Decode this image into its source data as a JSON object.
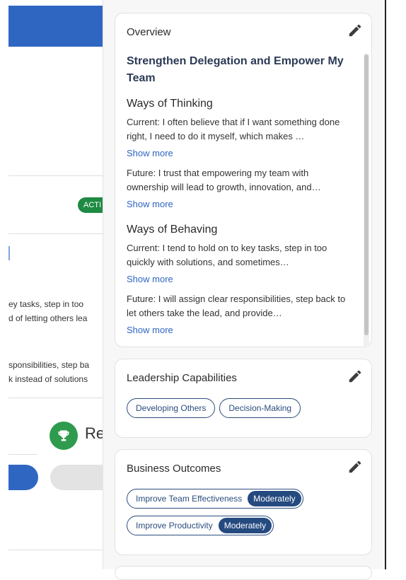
{
  "background": {
    "badge": "ACTI",
    "current_snippet_1": "ey tasks, step in too",
    "current_snippet_2": "d of letting others lea",
    "future_snippet_1": "sponsibilities, step ba",
    "future_snippet_2": "k instead of solutions",
    "section_heading": "Re"
  },
  "overview": {
    "title": "Overview",
    "goal_title": "Strengthen Delegation and Empower My Team",
    "thinking": {
      "title": "Ways of Thinking",
      "current": "Current: I often believe that if I want something done right, I need to do it myself, which makes …",
      "future": "Future: I trust that empowering my team with ownership will lead to growth, innovation, and…"
    },
    "behaving": {
      "title": "Ways of Behaving",
      "current": "Current: I tend to hold on to key tasks, step in too quickly with solutions, and sometimes…",
      "future": "Future: I will assign clear responsibilities, step back to let others take the lead, and provide…"
    },
    "show_more": "Show more"
  },
  "leadership": {
    "title": "Leadership Capabilities",
    "chips": [
      "Developing Others",
      "Decision-Making"
    ]
  },
  "outcomes": {
    "title": "Business Outcomes",
    "items": [
      {
        "label": "Improve Team Effectiveness",
        "level": "Moderately"
      },
      {
        "label": "Improve Productivity",
        "level": "Moderately"
      }
    ]
  },
  "icons": {
    "edit": "pencil-icon",
    "trophy": "trophy-icon"
  },
  "colors": {
    "accent": "#2f66c2",
    "chip_border": "#2b4d7e",
    "level_badge": "#254a80",
    "active_badge": "#1f8a43",
    "trophy": "#2e9b4e"
  }
}
